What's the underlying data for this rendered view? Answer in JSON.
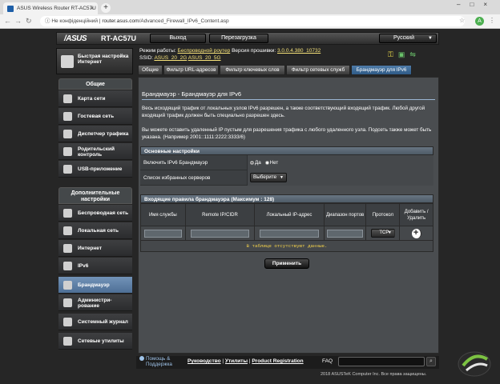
{
  "browser": {
    "tab_title": "ASUS Wireless Router RT-AC57U",
    "security_text": "Не конфіденційний",
    "url_host": "router.asus.com",
    "url_path": "/Advanced_Firewall_IPv6_Content.asp",
    "account_initial": "A"
  },
  "header": {
    "logo": "/ASUS",
    "model": "RT-AC57U",
    "logout": "Выход",
    "reboot": "Перезагрузка",
    "language": "Русский"
  },
  "info": {
    "mode_label": "Режим работы:",
    "mode_value": "Беспроводной роутер",
    "fw_label": "Версия прошивки:",
    "fw_value": "3.0.0.4.380_10732",
    "ssid_label": "SSID:",
    "ssid_1": "ASUS_20_2G",
    "ssid_2": "ASUS_20_5G"
  },
  "sidebar": {
    "quick": "Быстрая настройка Интернет",
    "general_header": "Общие",
    "general": [
      "Карта сети",
      "Гостевая сеть",
      "Диспетчер трафика",
      "Родительский контроль",
      "USB-приложение"
    ],
    "advanced_header": "Дополнительные настройки",
    "advanced": [
      "Беспроводная сеть",
      "Локальная сеть",
      "Интернет",
      "IPv6",
      "Брандмауэр",
      "Администри-рование",
      "Системный журнал",
      "Сетевые утилиты"
    ]
  },
  "tabs": [
    "Общие",
    "Фильтр URL-адресов",
    "Фильтр ключевых слов",
    "Фильтр сетевых служб",
    "Брандмауэр для IPv6"
  ],
  "panel": {
    "title": "Брандмауэр - Брандмауэр для IPv6",
    "desc1": "Весь исходящий трафик от локальных узлов IPv6 разрешен, а также соответствующий входящий трафик. Любой другой входящий трафик должен быть специально разрешен здесь.",
    "desc2": "Вы можете оставить удаленный IP пустым для разрешения трафика с любого удаленного узла. Подсеть также может быть указана. (Например 2001::1111:2222:3333/6)",
    "basic_header": "Основные настройки",
    "enable_label": "Включить IPv6 Брандмауэр",
    "yes": "Да",
    "no": "Нет",
    "servers_label": "Список избранных серверов",
    "servers_value": "Выберите",
    "rules_header": "Входящие правила брандмауэра (Максимум : 128)",
    "cols": [
      "Имя службы",
      "Remote IP/CIDR",
      "Локальный IP-адрес",
      "Диапазон портов",
      "Протокол",
      "Добавить / Удалить"
    ],
    "protocol_value": "TCP",
    "empty_text": "В таблице отсутствуют данные.",
    "apply": "Применить"
  },
  "footer": {
    "help": "Помощь & Поддержка",
    "manual": "Руководство",
    "utilities": "Утилиты",
    "product_reg": "Product Registration",
    "faq": "FAQ",
    "copyright": "2018 ASUSTeK Computer Inc. Все права защищены."
  }
}
